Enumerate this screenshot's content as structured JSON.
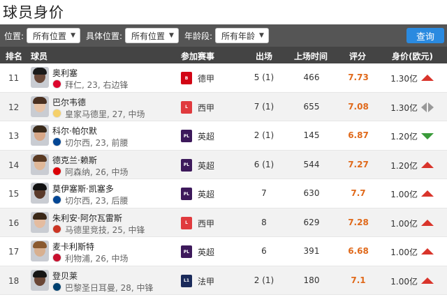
{
  "page_title": "球员身价",
  "filters": {
    "position_label": "位置:",
    "position_value": "所有位置",
    "specific_label": "具体位置:",
    "specific_value": "所有位置",
    "age_label": "年龄段:",
    "age_value": "所有年龄",
    "query_button": "查询"
  },
  "columns": {
    "rank": "排名",
    "player": "球员",
    "competition": "参加赛事",
    "apps": "出场",
    "minutes": "上场时间",
    "rating": "评分",
    "value": "身价(欧元)"
  },
  "colors": {
    "header_bg": "#444444",
    "filter_bg": "#555555",
    "query_button": "#2a8ae0",
    "rating": "#e0691a",
    "trend_up": "#d9342b",
    "trend_down": "#3a9b3a",
    "trend_flat": "#999999"
  },
  "rows": [
    {
      "rank": "11",
      "name": "奥利塞",
      "info": "拜仁, 23, 右边锋",
      "club": "bayern",
      "league": "德甲",
      "league_code": "bundesliga",
      "apps": "5 (1)",
      "minutes": "466",
      "rating": "7.73",
      "value": "1.30亿",
      "trend": "up"
    },
    {
      "rank": "12",
      "name": "巴尔韦德",
      "info": "皇家马德里, 27, 中场",
      "club": "real-madrid",
      "league": "西甲",
      "league_code": "laliga",
      "apps": "7 (1)",
      "minutes": "655",
      "rating": "7.08",
      "value": "1.30亿",
      "trend": "flat"
    },
    {
      "rank": "13",
      "name": "科尔·帕尔默",
      "info": "切尔西, 23, 前腰",
      "club": "chelsea",
      "league": "英超",
      "league_code": "premier-league",
      "apps": "2 (1)",
      "minutes": "145",
      "rating": "6.87",
      "value": "1.20亿",
      "trend": "down"
    },
    {
      "rank": "14",
      "name": "德克兰·赖斯",
      "info": "阿森纳, 26, 中场",
      "club": "arsenal",
      "league": "英超",
      "league_code": "premier-league",
      "apps": "6 (1)",
      "minutes": "544",
      "rating": "7.27",
      "value": "1.20亿",
      "trend": "up"
    },
    {
      "rank": "15",
      "name": "莫伊塞斯·凯塞多",
      "info": "切尔西, 23, 后腰",
      "club": "chelsea",
      "league": "英超",
      "league_code": "premier-league",
      "apps": "7",
      "minutes": "630",
      "rating": "7.7",
      "value": "1.00亿",
      "trend": "up"
    },
    {
      "rank": "16",
      "name": "朱利安·阿尔瓦雷斯",
      "info": "马德里竞技, 25, 中锋",
      "club": "atletico",
      "league": "西甲",
      "league_code": "laliga",
      "apps": "8",
      "minutes": "629",
      "rating": "7.28",
      "value": "1.00亿",
      "trend": "up"
    },
    {
      "rank": "17",
      "name": "麦卡利斯特",
      "info": "利物浦, 26, 中场",
      "club": "liverpool",
      "league": "英超",
      "league_code": "premier-league",
      "apps": "6",
      "minutes": "391",
      "rating": "6.68",
      "value": "1.00亿",
      "trend": "up"
    },
    {
      "rank": "18",
      "name": "登贝莱",
      "info": "巴黎圣日耳曼, 28, 中锋",
      "club": "psg",
      "league": "法甲",
      "league_code": "ligue1",
      "apps": "2 (1)",
      "minutes": "180",
      "rating": "7.1",
      "value": "1.00亿",
      "trend": "up"
    }
  ]
}
